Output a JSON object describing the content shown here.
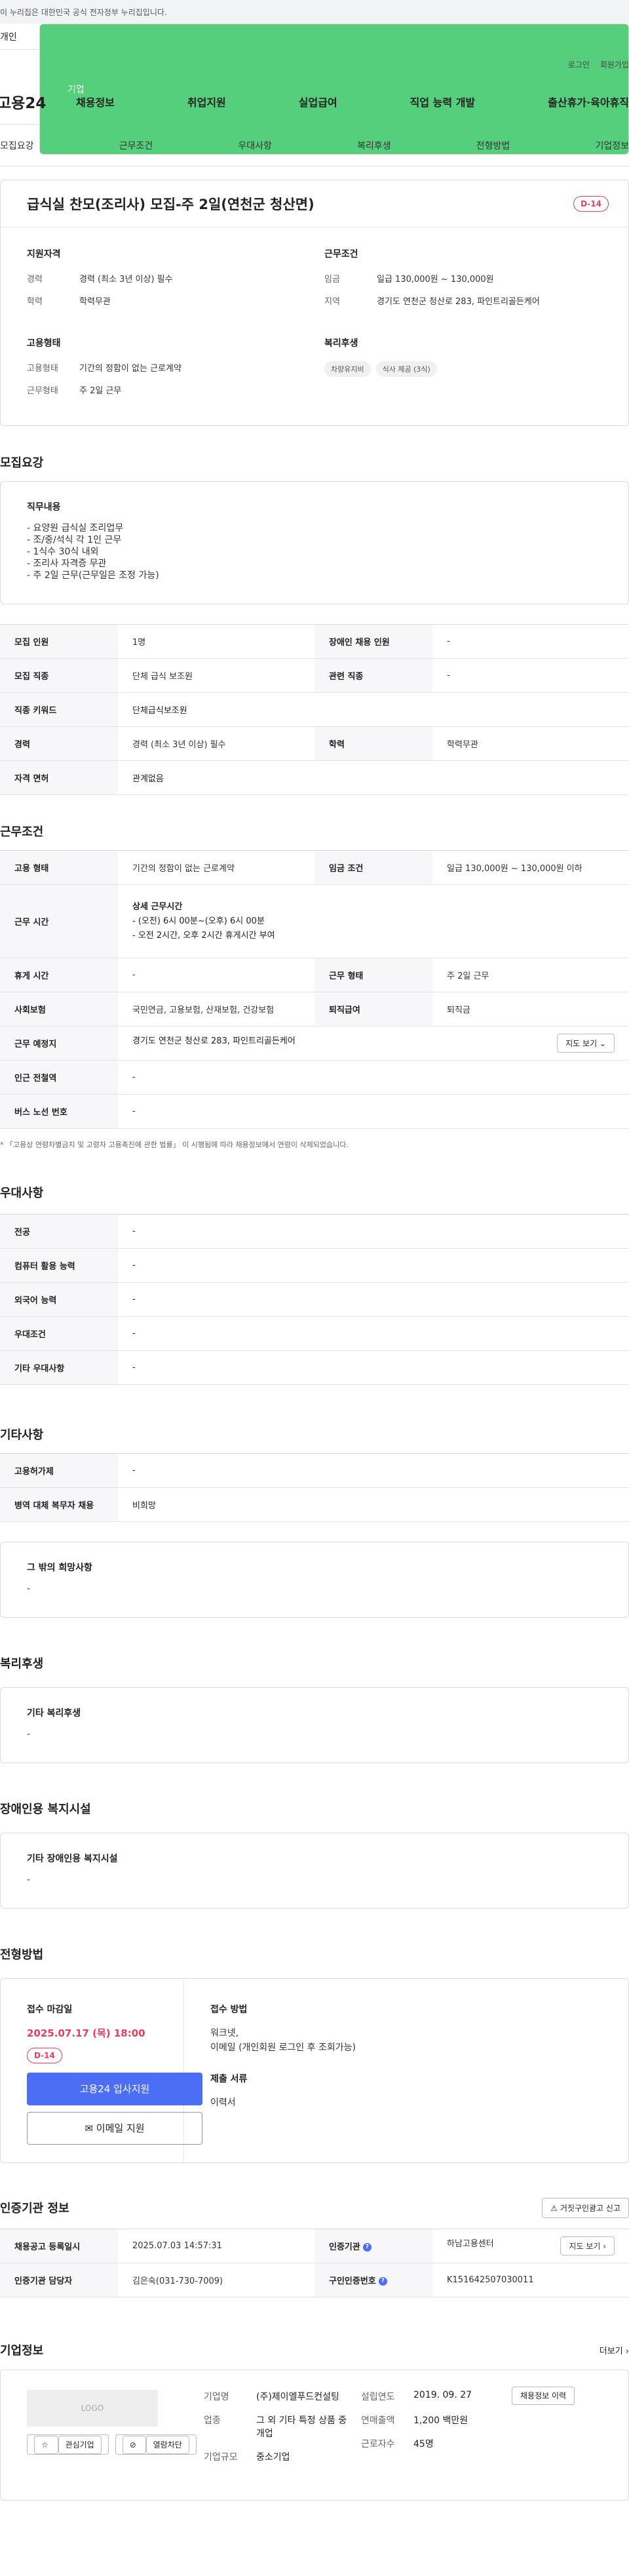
{
  "gov_banner": "이 누리집은 대한민국 공식 전자정부 누리집입니다.",
  "user_tabs": {
    "personal": "개인",
    "company": "기업"
  },
  "util": {
    "login": "로그인",
    "join": "회원가입"
  },
  "gnb": {
    "logo": "고용24",
    "menu": [
      "채용정보",
      "취업지원",
      "실업급여",
      "직업 능력 개발",
      "출산휴가·육아휴직"
    ]
  },
  "anchors": [
    "모집요강",
    "근무조건",
    "우대사항",
    "복리후생",
    "전형방법",
    "기업정보"
  ],
  "summary": {
    "title": "급식실 찬모(조리사) 모집-주 2일(연천군 청산면)",
    "dday": "D-14",
    "qual_title": "지원자격",
    "qual_career_k": "경력",
    "qual_career_v": "경력 (최소 3년 이상) 필수",
    "qual_edu_k": "학력",
    "qual_edu_v": "학력무관",
    "cond_title": "근무조건",
    "cond_wage_k": "임금",
    "cond_wage_v": "일급 130,000원 ~ 130,000원",
    "cond_area_k": "지역",
    "cond_area_v": "경기도 연천군 청산로 283, 파인트리골든케어",
    "emp_title": "고용형태",
    "emp_type_k": "고용형태",
    "emp_type_v": "기간의 정함이 없는 근로계약",
    "emp_form_k": "근무형태",
    "emp_form_v": "주 2일 근무",
    "welfare_title": "복리후생",
    "welfare_chips": [
      "차량유지비",
      "식사 제공 (3식)"
    ]
  },
  "recruit": {
    "title": "모집요강",
    "duty_title": "직무내용",
    "duty_lines": [
      "- 요양원 급식실 조리업무",
      "- 조/중/석식 각 1인 근무",
      "- 1식수 30식 내외",
      "- 조리사 자격증 무관",
      "- 주 2일 근무(근무일은 조정 가능)"
    ],
    "rows": [
      [
        "모집 인원",
        "1명",
        "장애인 채용 인원",
        "-"
      ],
      [
        "모집 직종",
        "단체 급식 보조원",
        "관련 직종",
        "-"
      ],
      [
        "직종 키워드",
        "단체급식보조원",
        "",
        ""
      ],
      [
        "경력",
        "경력 (최소 3년 이상) 필수",
        "학력",
        "학력무관"
      ],
      [
        "자격 면허",
        "관계없음",
        "",
        ""
      ]
    ]
  },
  "work": {
    "title": "근무조건",
    "r1": [
      "고용 형태",
      "기간의 정함이 없는 근로계약",
      "임금 조건",
      "일급 130,000원 ~ 130,000원 이하"
    ],
    "time_k": "근무 시간",
    "time_title": "상세 근무시간",
    "time_lines": [
      "- (오전) 6시 00분~(오후) 6시 00분",
      "- 오전 2시간, 오후 2시간 휴게시간 부여"
    ],
    "r3": [
      "휴게 시간",
      "-",
      "근무 형태",
      "주 2일 근무"
    ],
    "r4": [
      "사회보험",
      "국민연금, 고용보험, 산재보험, 건강보험",
      "퇴직급여",
      "퇴직금"
    ],
    "addr_k": "근무 예정지",
    "addr_v": "경기도 연천군 청산로 283, 파인트리골든케어",
    "map_btn": "지도 보기 ⌄",
    "r6": [
      "인근 전철역",
      "-"
    ],
    "r7": [
      "버스 노선 번호",
      "-"
    ],
    "note": "* 「고용상 연령차별금지 및 고령자 고용촉진에 관한 법률」 이 시행됨에 따라 채용정보에서 연령이 삭제되었습니다."
  },
  "pref": {
    "title": "우대사항",
    "rows": [
      [
        "전공",
        "-"
      ],
      [
        "컴퓨터 활용 능력",
        "-"
      ],
      [
        "외국어 능력",
        "-"
      ],
      [
        "우대조건",
        "-"
      ],
      [
        "기타 우대사항",
        "-"
      ]
    ]
  },
  "etc": {
    "title": "기타사항",
    "rows": [
      [
        "고용허가제",
        "-"
      ],
      [
        "병역 대체 복무자 채용",
        "비희망"
      ]
    ],
    "box_title": "그 밖의 희망사항",
    "box_val": "-"
  },
  "welfare": {
    "title": "복리후생",
    "box_title": "기타 복리후생",
    "box_val": "-"
  },
  "disabled": {
    "title": "장애인용 복지시설",
    "box_title": "기타 장애인용 복지시설",
    "box_val": "-"
  },
  "process": {
    "title": "전형방법",
    "deadline_title": "접수 마감일",
    "deadline": "2025.07.17 (목) 18:00",
    "dday": "D-14",
    "apply_btn": "고용24 입사지원",
    "email_btn": "이메일 지원",
    "method_title": "접수 방법",
    "method_lines": [
      "워크넷,",
      "이메일 (개인회원 로그인 후 조회가능)"
    ],
    "docs_title": "제출 서류",
    "docs_val": "이력서"
  },
  "agency": {
    "title": "인증기관 정보",
    "report_btn": "거짓구인광고 신고",
    "r1": [
      "채용공고 등록일시",
      "2025.07.03 14:57:31",
      "인증기관",
      "하남고용센터"
    ],
    "r2": [
      "인증기관 담당자",
      "김은숙(031-730-7009)",
      "구인인증번호",
      "K151642507030011"
    ],
    "map_btn": "지도 보기 ›"
  },
  "company": {
    "title": "기업정보",
    "more": "더보기 ›",
    "logo": "LOGO",
    "fav_btn": "관심기업",
    "block_btn": "열람차단",
    "name_k": "기업명",
    "name_v": "(주)제이엘푸드컨설팅",
    "biz_k": "업종",
    "biz_v": "그 외 기타 특정 상품 중개업",
    "scale_k": "기업규모",
    "scale_v": "중소기업",
    "est_k": "설립연도",
    "est_v": "2019. 09. 27",
    "sales_k": "연매출액",
    "sales_v": "1,200 백만원",
    "emp_k": "근로자수",
    "emp_v": "45명",
    "hist_btn": "채용정보 이력"
  }
}
